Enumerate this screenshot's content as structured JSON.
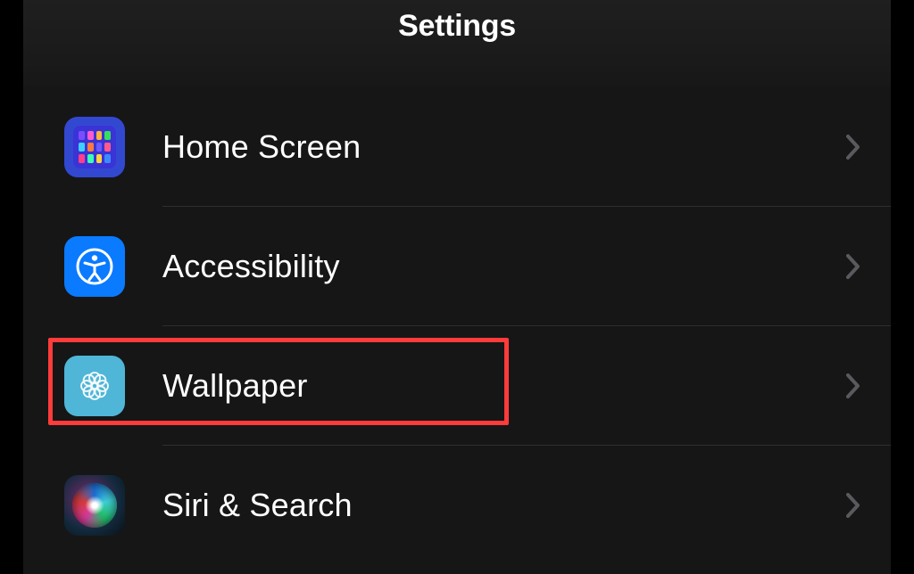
{
  "header": {
    "title": "Settings"
  },
  "rows": [
    {
      "label": "Home Screen",
      "icon": "home-screen-icon"
    },
    {
      "label": "Accessibility",
      "icon": "accessibility-icon"
    },
    {
      "label": "Wallpaper",
      "icon": "wallpaper-icon",
      "highlighted": true
    },
    {
      "label": "Siri & Search",
      "icon": "siri-icon"
    }
  ],
  "colors": {
    "highlight": "#ff3b3b",
    "chevron": "#5a5a5e"
  }
}
